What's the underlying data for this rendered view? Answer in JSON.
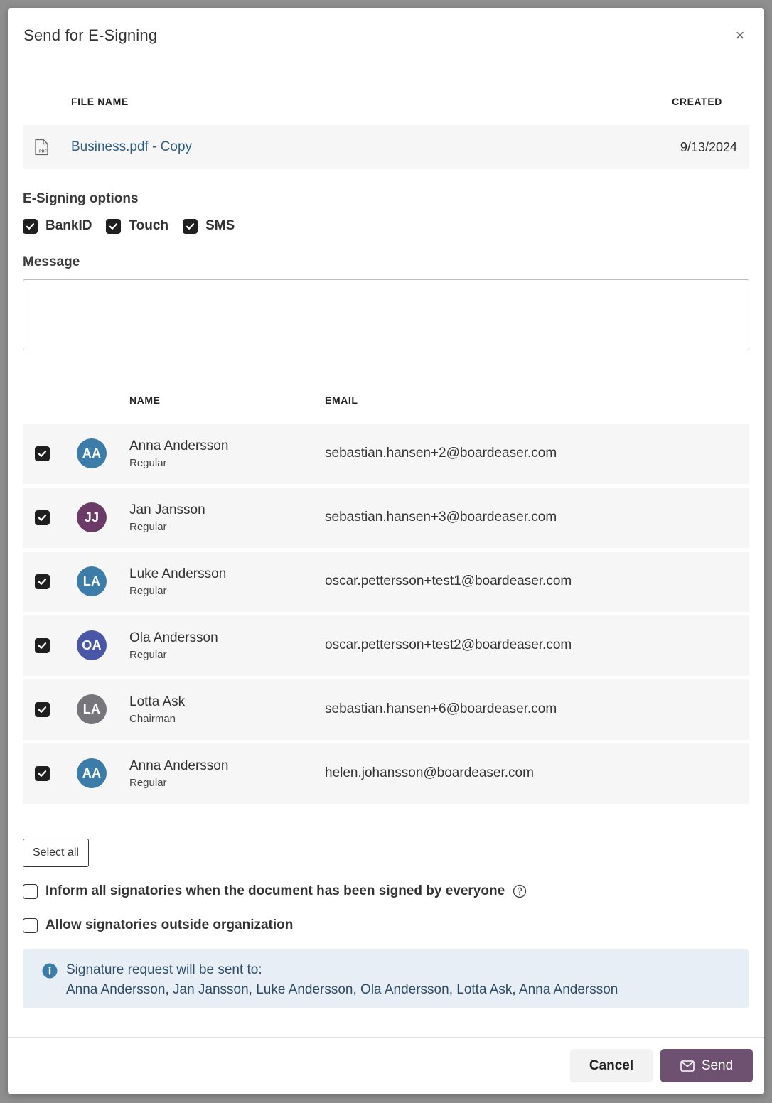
{
  "dialog": {
    "title": "Send for E-Signing",
    "close_label": "×"
  },
  "file_table": {
    "col_name": "FILE NAME",
    "col_created": "CREATED",
    "file": {
      "name": "Business.pdf - Copy",
      "created": "9/13/2024",
      "icon": "pdf-file-icon"
    }
  },
  "esign_options": {
    "label": "E-Signing options",
    "options": [
      {
        "label": "BankID",
        "checked": true
      },
      {
        "label": "Touch",
        "checked": true
      },
      {
        "label": "SMS",
        "checked": true
      }
    ]
  },
  "message": {
    "label": "Message",
    "value": "",
    "placeholder": ""
  },
  "signatories": {
    "col_name": "NAME",
    "col_email": "EMAIL",
    "rows": [
      {
        "initials": "AA",
        "name": "Anna Andersson",
        "role": "Regular",
        "email": "sebastian.hansen+2@boardeaser.com",
        "color": "#3b7ca9",
        "checked": true
      },
      {
        "initials": "JJ",
        "name": "Jan Jansson",
        "role": "Regular",
        "email": "sebastian.hansen+3@boardeaser.com",
        "color": "#6b3a67",
        "checked": true
      },
      {
        "initials": "LA",
        "name": "Luke Andersson",
        "role": "Regular",
        "email": "oscar.pettersson+test1@boardeaser.com",
        "color": "#3b7ca9",
        "checked": true
      },
      {
        "initials": "OA",
        "name": "Ola Andersson",
        "role": "Regular",
        "email": "oscar.pettersson+test2@boardeaser.com",
        "color": "#4a56a6",
        "checked": true
      },
      {
        "initials": "LA",
        "name": "Lotta Ask",
        "role": "Chairman",
        "email": "sebastian.hansen+6@boardeaser.com",
        "color": "#77757c",
        "checked": true
      },
      {
        "initials": "AA",
        "name": "Anna Andersson",
        "role": "Regular",
        "email": "helen.johansson@boardeaser.com",
        "color": "#3b7ca9",
        "checked": true
      }
    ]
  },
  "select_all_label": "Select all",
  "inform_all": {
    "label": "Inform all signatories when the document has been signed by everyone",
    "checked": false
  },
  "allow_outside": {
    "label": "Allow signatories outside organization",
    "checked": false
  },
  "info": {
    "title": "Signature request will be sent to:",
    "names": "Anna Andersson, Jan Jansson, Luke Andersson, Ola Andersson, Lotta Ask, Anna Andersson"
  },
  "footer": {
    "cancel_label": "Cancel",
    "send_label": "Send"
  },
  "colors": {
    "primary": "#6e5170",
    "link": "#2d5f86",
    "info_bg": "#e7eef5"
  }
}
